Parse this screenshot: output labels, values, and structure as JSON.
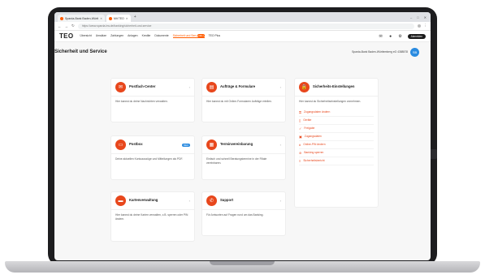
{
  "browser": {
    "tabs": [
      {
        "label": "Sparda-Bank Baden-Württ",
        "active": false
      },
      {
        "label": "Mit TEO",
        "active": true
      }
    ],
    "new_tab": "+",
    "url": "https://www.sparda-bw.de/banking/sicherheit-und-service"
  },
  "site": {
    "logo": "TEO",
    "nav": [
      "Übersicht",
      "Umsätze",
      "Zahlungen",
      "Anlagen",
      "Kredite",
      "Dokumente",
      "Sicherheit und Serv",
      "TEO Plus"
    ],
    "nav_badge": "NEU",
    "logout": "Abmelden"
  },
  "page": {
    "title": "Sicherheit und Service",
    "account_label": "Sparda-Bank Baden-Württemberg eG 4388578",
    "avatar_initials": "SB"
  },
  "cards": [
    {
      "title": "Postfach-Center",
      "desc": "Hier kannst du deine Nachrichten verwalten."
    },
    {
      "title": "Aufträge & Formulare",
      "desc": "Hier kannst du mit Online-Formularen Aufträge erteilen."
    },
    {
      "title": "Sicherheits-Einstellungen",
      "desc": "Hier kannst du Sicherheitseinstellungen vornehmen."
    },
    {
      "title": "Postbox",
      "desc": "Deine aktuellen Kontoauszüge und Mitteilungen als PDF.",
      "badge": "NEU"
    },
    {
      "title": "Terminvereinbarung",
      "desc": "Einfach und schnell Beratungstermine in der Filiale vereinbaren."
    },
    {
      "title": "Kartenverwaltung",
      "desc": "Hier kannst du deine Karten verwalten, z.B. sperren oder PIN ändern."
    },
    {
      "title": "Support",
      "desc": "Für Antworten auf Fragen rund um das Banking."
    }
  ],
  "security_items": [
    "Zugangsdaten ändern",
    "Geräte",
    "Freigabe",
    "Zugangsdaten",
    "Online-PIN ändern",
    "Banking sperren",
    "Sicherheitsbericht"
  ],
  "colors": {
    "accent": "#ff5c00",
    "icon_bg": "#e8471c",
    "avatar": "#2a8be0"
  }
}
